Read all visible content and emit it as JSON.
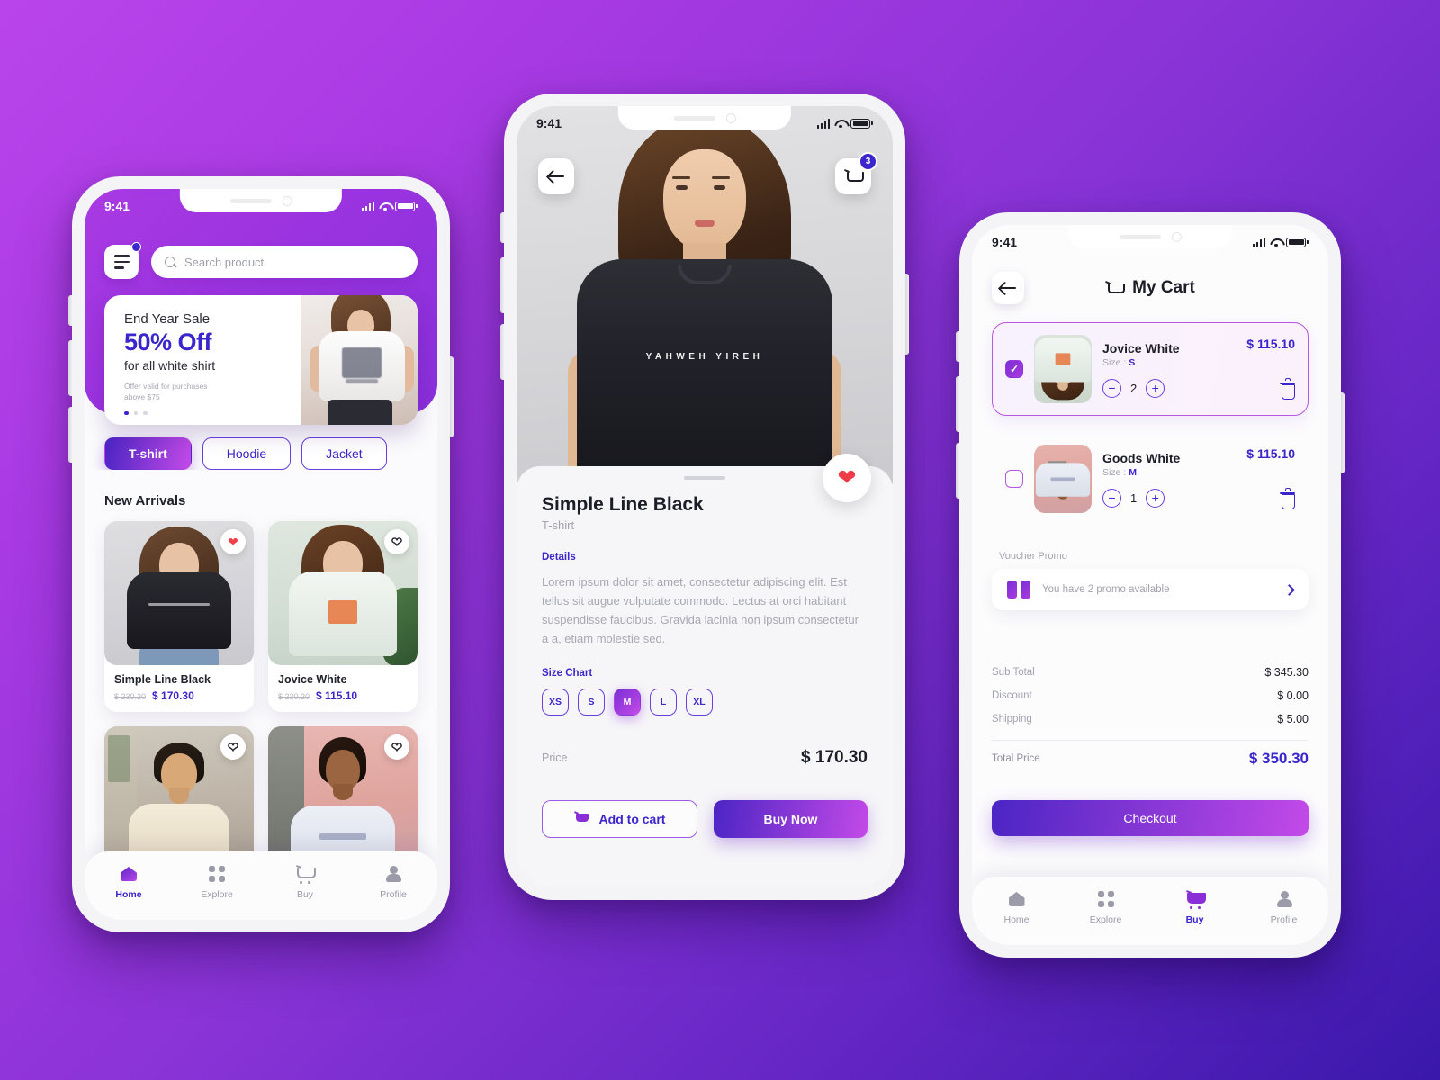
{
  "status_bar": {
    "time": "9:41"
  },
  "phone1": {
    "menu_icon": "hamburger-menu-icon",
    "search": {
      "placeholder": "Search product",
      "icon": "search-icon"
    },
    "banner": {
      "line1": "End Year Sale",
      "line2": "50% Off",
      "line3": "for all white shirt",
      "fine_print_1": "Offer valid for purchases",
      "fine_print_2": "above $75",
      "dots": 3,
      "active_dot": 0
    },
    "categories": [
      {
        "label": "T-shirt",
        "active": true
      },
      {
        "label": "Hoodie",
        "active": false
      },
      {
        "label": "Jacket",
        "active": false
      }
    ],
    "section_title": "New Arrivals",
    "products": [
      {
        "name": "Simple Line Black",
        "old_price": "$ 230.20",
        "price": "$ 170.30",
        "favorited": true
      },
      {
        "name": "Jovice White",
        "old_price": "$ 230.20",
        "price": "$ 115.10",
        "favorited": false
      },
      {
        "name": "",
        "old_price": "",
        "price": "",
        "favorited": false
      },
      {
        "name": "",
        "old_price": "",
        "price": "",
        "favorited": false
      }
    ],
    "nav": [
      {
        "label": "Home",
        "icon": "home-icon",
        "active": true
      },
      {
        "label": "Explore",
        "icon": "grid-icon",
        "active": false
      },
      {
        "label": "Buy",
        "icon": "cart-icon",
        "active": false
      },
      {
        "label": "Profile",
        "icon": "user-icon",
        "active": false
      }
    ]
  },
  "phone2": {
    "back_icon": "back-arrow-icon",
    "cart_icon": "cart-icon",
    "cart_badge": "3",
    "shirt_print": "YAHWEH YIREH",
    "favorite_icon": "heart-icon",
    "title": "Simple Line Black",
    "subtitle": "T-shirt",
    "details_label": "Details",
    "description": "Lorem ipsum dolor sit amet, consectetur adipiscing elit. Est tellus sit augue vulputate commodo. Lectus at orci habitant suspendisse faucibus. Gravida lacinia non ipsum consectetur a a, etiam molestie sed.",
    "size_chart_label": "Size Chart",
    "sizes": [
      {
        "label": "XS",
        "active": false
      },
      {
        "label": "S",
        "active": false
      },
      {
        "label": "M",
        "active": true
      },
      {
        "label": "L",
        "active": false
      },
      {
        "label": "XL",
        "active": false
      }
    ],
    "price_label": "Price",
    "price_value": "$ 170.30",
    "add_to_cart": "Add to cart",
    "buy_now": "Buy Now"
  },
  "phone3": {
    "back_icon": "back-arrow-icon",
    "title": "My Cart",
    "title_icon": "cart-icon",
    "items": [
      {
        "name": "Jovice White",
        "size_label": "Size :",
        "size": "S",
        "price": "$ 115.10",
        "qty": "2",
        "selected": true
      },
      {
        "name": "Goods White",
        "size_label": "Size :",
        "size": "M",
        "price": "$ 115.10",
        "qty": "1",
        "selected": false
      }
    ],
    "voucher_label": "Voucher Promo",
    "voucher_text": "You have 2 promo available",
    "voucher_icon": "ticket-icon",
    "summary": [
      {
        "label": "Sub Total",
        "value": "$ 345.30"
      },
      {
        "label": "Discount",
        "value": "$ 0.00"
      },
      {
        "label": "Shipping",
        "value": "$ 5.00"
      }
    ],
    "total_label": "Total Price",
    "total_value": "$ 350.30",
    "checkout": "Checkout",
    "nav": [
      {
        "label": "Home",
        "icon": "home-icon",
        "active": false
      },
      {
        "label": "Explore",
        "icon": "grid-icon",
        "active": false
      },
      {
        "label": "Buy",
        "icon": "cart-icon",
        "active": true
      },
      {
        "label": "Profile",
        "icon": "user-icon",
        "active": false
      }
    ]
  }
}
